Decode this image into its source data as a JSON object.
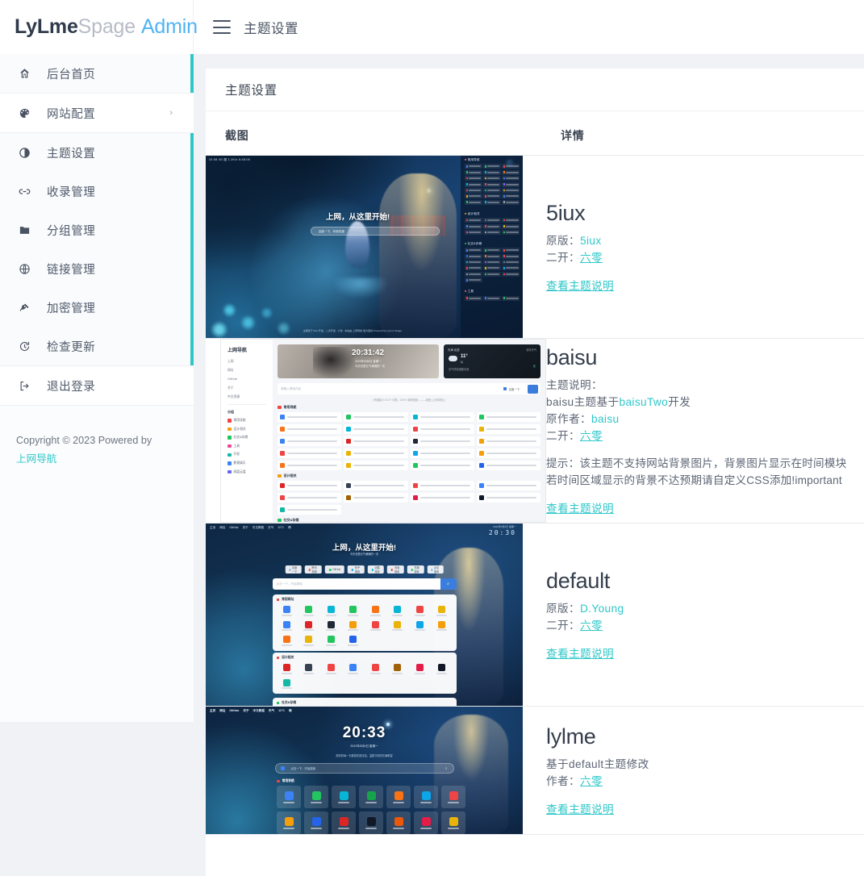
{
  "brand": {
    "part1": "LyLme",
    "part2": "Spage",
    "part3": "Admin"
  },
  "header": {
    "menu_icon": "hamburger-icon",
    "title": "主题设置"
  },
  "sidebar": {
    "items": [
      {
        "label": "后台首页",
        "icon": "home-icon",
        "active": true,
        "chevron": ""
      },
      {
        "label": "网站配置",
        "icon": "palette-icon",
        "active": false,
        "chevron": "›"
      },
      {
        "label": "主题设置",
        "icon": "contrast-icon",
        "active": true,
        "chevron": ""
      },
      {
        "label": "收录管理",
        "icon": "link-icon",
        "active": true,
        "chevron": ""
      },
      {
        "label": "分组管理",
        "icon": "folder-icon",
        "active": true,
        "chevron": ""
      },
      {
        "label": "链接管理",
        "icon": "globe-icon",
        "active": true,
        "chevron": ""
      },
      {
        "label": "加密管理",
        "icon": "key-icon",
        "active": true,
        "chevron": ""
      },
      {
        "label": "检查更新",
        "icon": "refresh-icon",
        "active": true,
        "chevron": ""
      },
      {
        "label": "退出登录",
        "icon": "logout-icon",
        "active": false,
        "chevron": ""
      }
    ],
    "footer": {
      "copyright": "Copyright © 2023 Powered by",
      "link": "上网导航"
    }
  },
  "panel": {
    "title": "主题设置",
    "columns": {
      "screenshot": "截图",
      "detail": "详情"
    }
  },
  "themes": [
    {
      "name": "5iux",
      "lines": [
        {
          "label": "原版：",
          "value": "5iux",
          "link": true
        },
        {
          "label": "二开：",
          "value": "六零",
          "link": true
        }
      ],
      "link_label": "查看主题说明",
      "preview": {
        "hero_title": "上网，从这里开始!",
        "search_placeholder": "百度一下，你就知道",
        "statusbar": "10:08  4G  图 1.2K/s  5:48:05",
        "panels": [
          {
            "title": "常用导航",
            "marker_color": "#ff6b6b"
          },
          {
            "title": "设计相关",
            "marker_color": "#f59e0b"
          },
          {
            "title": "社交&存储",
            "marker_color": "#22c55e"
          },
          {
            "title": "工具",
            "marker_color": "#ef4444"
          }
        ],
        "footer": "主题基于 5iux 开发，二次开发：六零 · 本站由 上网导航 强力驱动 Powered by LyLme Spage"
      }
    },
    {
      "name": "baisu",
      "desc_title": "主题说明：",
      "desc_line": {
        "pre": "baisu主题基于",
        "link": "baisuTwo",
        "post": "开发"
      },
      "lines": [
        {
          "label": "原作者：",
          "value": "baisu",
          "link": true
        },
        {
          "label": "二开：",
          "value": "六零",
          "link": true
        }
      ],
      "notes": [
        "提示：该主题不支持网站背景图片，背景图片显示在时间模块",
        "若时间区域显示的背景不达预期请自定义CSS添加!important"
      ],
      "link_label": "查看主题说明",
      "preview": {
        "logo": "上网导航",
        "nav_links": [
          "上网",
          "网址",
          "GitHub",
          "关于",
          "中文资源"
        ],
        "group_title": "分组",
        "categories": [
          {
            "label": "常用导航",
            "color": "#ef4444"
          },
          {
            "label": "设计相关",
            "color": "#f59e0b"
          },
          {
            "label": "社交&存储",
            "color": "#22c55e"
          },
          {
            "label": "工具",
            "color": "#ec4899"
          },
          {
            "label": "开发",
            "color": "#14b8a6"
          },
          {
            "label": "影视娱乐",
            "color": "#3b82f6"
          },
          {
            "label": "网盘云盘",
            "color": "#6366f1"
          }
        ],
        "clock": "20:31:42",
        "clock_date": "2023年5月8日 星期一",
        "clock_sub": "今天也是元气满满的一天",
        "weather_city": "天津 北辰",
        "weather_right": "实时天气",
        "weather_temp": "11°",
        "weather_unit": "晴",
        "weather_desc": "空气质量指数优良",
        "weather_good": "优",
        "search_placeholder": "请输入搜索内容",
        "search_engine": "百度一下",
        "hint": "[ 快捷键 A S D F 切换，Ctrl+K 聚焦搜索，——键盘 (上网导航) ]",
        "sections": [
          {
            "title": "常用导航",
            "color": "#ef4444",
            "rows": 5
          },
          {
            "title": "设计相关",
            "color": "#f59e0b",
            "rows": 2
          },
          {
            "title": "社交&存储",
            "color": "#22c55e",
            "rows": 2
          }
        ]
      }
    },
    {
      "name": "default",
      "lines": [
        {
          "label": "原版：",
          "value": "D.Young",
          "link": true
        },
        {
          "label": "二开：",
          "value": "六零",
          "link": true
        }
      ],
      "link_label": "查看主题说明",
      "preview": {
        "nav_links": [
          "主页",
          "网址",
          "GitHub",
          "关于",
          "中文教程",
          "天气",
          "11°C",
          "晴"
        ],
        "clock": "20:30",
        "clock_sub": "2023年5月8日 星期一",
        "hero_title": "上网，从这里开始!",
        "hero_sub": "今天也是元气满满的一天",
        "pills": [
          "百度一下",
          "腾讯视频",
          "GitHub",
          "知乎搜索",
          "站酷搜索",
          "淘宝搜索",
          "豆瓣搜索",
          "必应搜索"
        ],
        "search_placeholder": "点击一下，开始搜索",
        "sections": [
          {
            "title": "常用网址",
            "color": "#ef4444"
          },
          {
            "title": "设计相关",
            "color": "#ef4444"
          },
          {
            "title": "社交&存储",
            "color": "#22c55e"
          }
        ]
      }
    },
    {
      "name": "lylme",
      "desc": "基于default主题修改",
      "lines": [
        {
          "label": "作者：",
          "value": "六零",
          "link": true
        }
      ],
      "link_label": "查看主题说明",
      "preview": {
        "nav_links": [
          "主页",
          "网址",
          "GitHub",
          "关于",
          "中文教程",
          "天气",
          "11°C",
          "晴"
        ],
        "clock": "20:33",
        "date": "2023年5月8日 星期一",
        "quote": "愿你的每一天都如初夏清晨，温柔又明亮充满希望",
        "search_placeholder": "点击一下，开始搜索",
        "group_title": "常用导航"
      }
    }
  ],
  "colors": {
    "accent": "#2ec7c9",
    "brand_blue": "#4fb3f3",
    "page_bg": "#f1f2f6",
    "sidebar_bg": "#fafbfc",
    "text": "#3c4858"
  }
}
